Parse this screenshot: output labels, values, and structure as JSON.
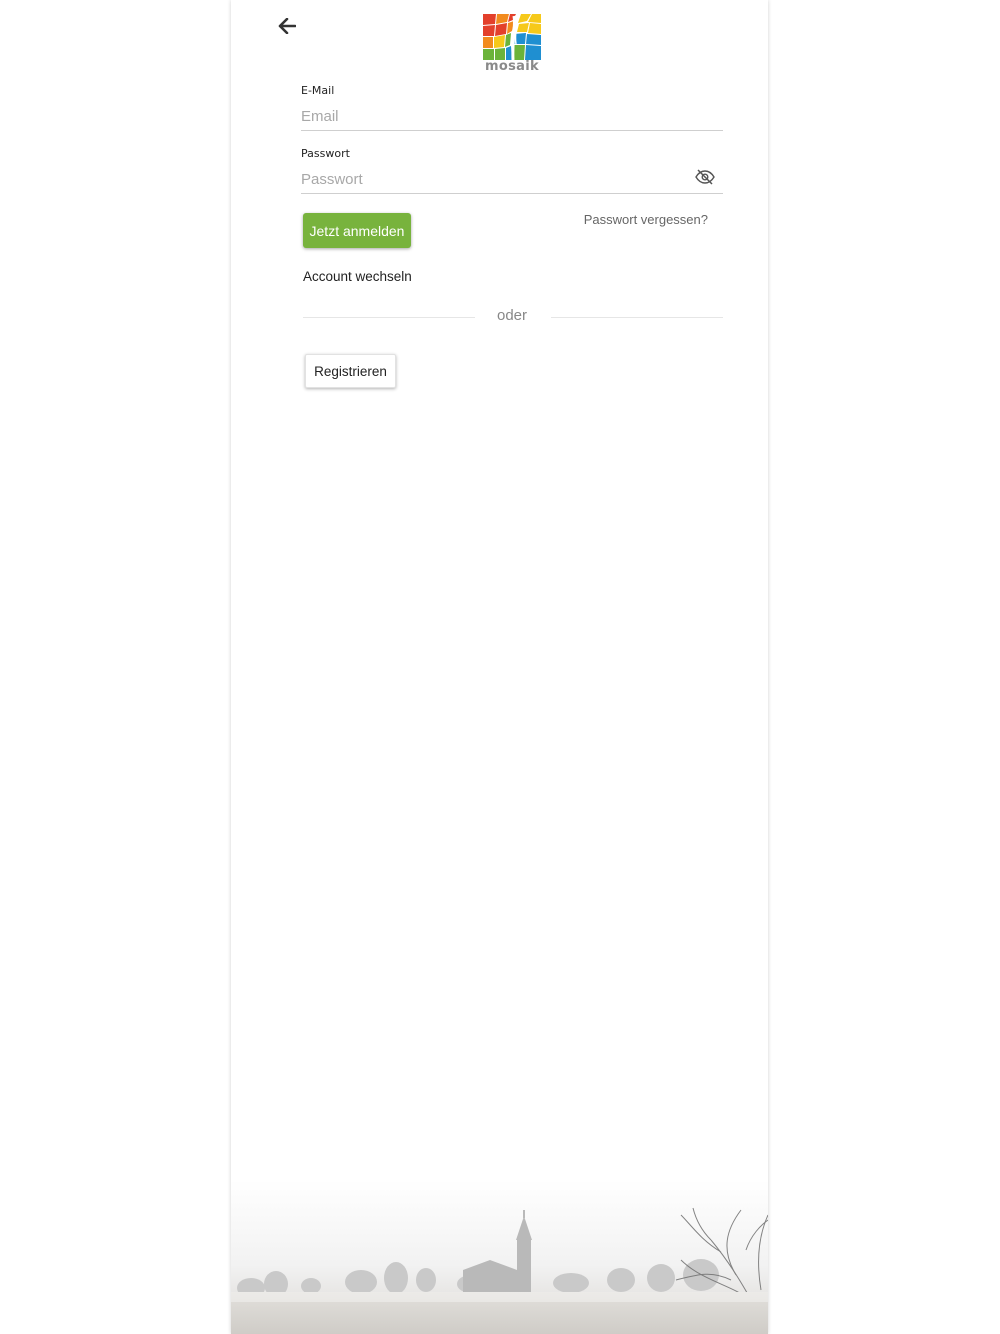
{
  "header": {
    "back_icon": "arrow-left-icon",
    "logo_text": "mosaik"
  },
  "login_form": {
    "email_label": "E-Mail",
    "email_placeholder": "Email",
    "email_value": "",
    "password_label": "Passwort",
    "password_placeholder": "Passwort",
    "password_value": "",
    "visibility_icon": "eye-off-icon",
    "login_button": "Jetzt anmelden",
    "forgot_password": "Passwort vergessen?",
    "switch_account": "Account wechseln"
  },
  "divider": {
    "text": "oder"
  },
  "register": {
    "button": "Registrieren"
  },
  "colors": {
    "accent_green": "#78b33d",
    "logo_red": "#e3402b",
    "logo_orange": "#f28b1e",
    "logo_yellow": "#f6c91a",
    "logo_green": "#6bb33a",
    "logo_blue": "#1f8fd1",
    "logo_text": "#8a8a8a"
  }
}
